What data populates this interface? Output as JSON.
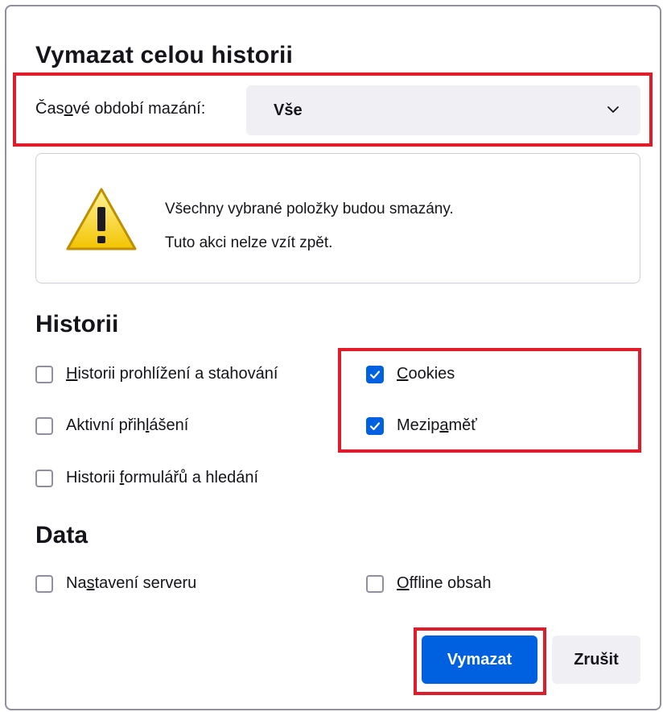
{
  "dialog": {
    "title": "Vymazat celou historii"
  },
  "time_range": {
    "label_before": "Čas",
    "label_accesskey": "o",
    "label_after": "vé období mazání:",
    "selected": "Vše"
  },
  "warning": {
    "line1": "Všechny vybrané položky budou smazány.",
    "line2": "Tuto akci nelze vzít zpět."
  },
  "history_section": {
    "heading": "Historii",
    "items": [
      {
        "before": "",
        "accesskey": "H",
        "after": "istorii prohlížení a stahování",
        "checked": false
      },
      {
        "before": "Aktivní přih",
        "accesskey": "l",
        "after": "ášení",
        "checked": false
      },
      {
        "before": "Historii ",
        "accesskey": "f",
        "after": "ormulářů a hledání",
        "checked": false
      },
      {
        "before": "",
        "accesskey": "C",
        "after": "ookies",
        "checked": true
      },
      {
        "before": "Mezip",
        "accesskey": "a",
        "after": "měť",
        "checked": true
      }
    ]
  },
  "data_section": {
    "heading": "Data",
    "items": [
      {
        "before": "Na",
        "accesskey": "s",
        "after": "tavení serveru",
        "checked": false
      },
      {
        "before": "",
        "accesskey": "O",
        "after": "ffline obsah",
        "checked": false
      }
    ]
  },
  "buttons": {
    "clear": "Vymazat",
    "cancel": "Zrušit"
  },
  "colors": {
    "accent": "#0061e0",
    "highlight": "#e21b2a",
    "field_background": "#f0f0f4"
  },
  "icons": {
    "select_arrow": "chevron-down-icon",
    "warning": "warning-triangle-icon",
    "checkmark": "checkmark-icon"
  }
}
